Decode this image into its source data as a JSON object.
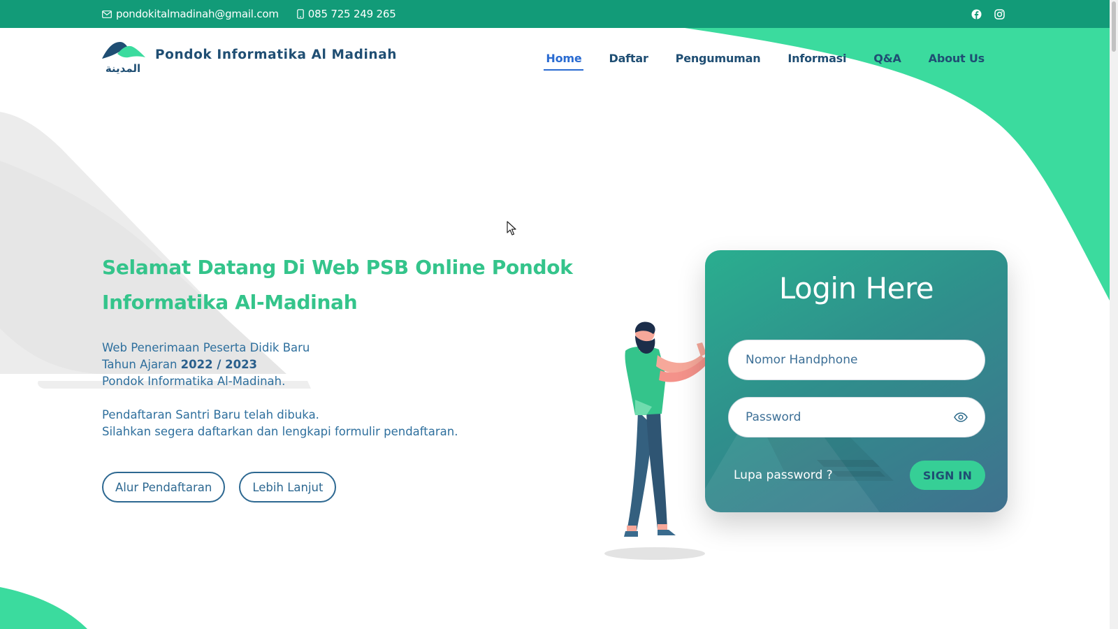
{
  "topbar": {
    "email": "pondokitalmadinah@gmail.com",
    "phone": "085 725 249 265",
    "social": [
      "facebook-icon",
      "instagram-icon"
    ]
  },
  "brand": {
    "name": "Pondok Informatika Al Madinah",
    "logo_text": "المدينة"
  },
  "nav": {
    "items": [
      "Home",
      "Daftar",
      "Pengumuman",
      "Informasi",
      "Q&A",
      "About Us"
    ],
    "active": "Home"
  },
  "hero": {
    "title_line1": "Selamat Datang Di Web PSB Online Pondok",
    "title_line2": "Informatika Al-Madinah",
    "line1": "Web Penerimaan Peserta Didik Baru",
    "line2_prefix": "Tahun Ajaran",
    "line2_year": "2022 / 2023",
    "line3": "Pondok Informatika Al-Madinah.",
    "line4": "Pendaftaran Santri Baru telah dibuka.",
    "line5": "Silahkan segera daftarkan dan lengkapi formulir pendaftaran.",
    "btn_alur": "Alur Pendaftaran",
    "btn_lanjut": "Lebih Lanjut"
  },
  "login": {
    "title": "Login Here",
    "phone_placeholder": "Nomor Handphone",
    "password_placeholder": "Password",
    "forgot": "Lupa password ?",
    "signin": "SIGN IN"
  },
  "colors": {
    "topbar": "#129b78",
    "accent": "#34c48b",
    "heading": "#1f4e73",
    "active_link": "#2a6bd1",
    "signin": "#36cf96"
  }
}
